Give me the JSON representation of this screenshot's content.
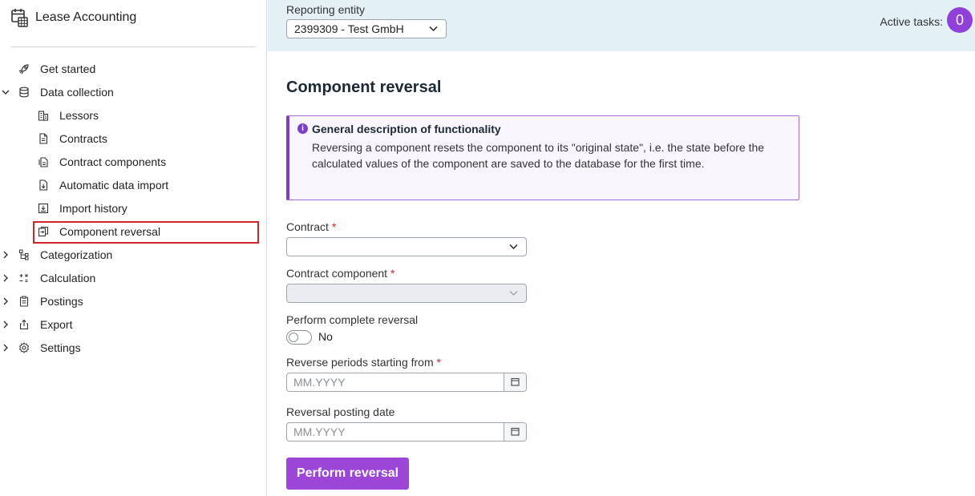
{
  "app": {
    "title": "Lease Accounting"
  },
  "sidebar": {
    "items": [
      {
        "label": "Get started"
      },
      {
        "label": "Data collection"
      },
      {
        "label": "Lessors"
      },
      {
        "label": "Contracts"
      },
      {
        "label": "Contract components"
      },
      {
        "label": "Automatic data import"
      },
      {
        "label": "Import history"
      },
      {
        "label": "Component reversal"
      },
      {
        "label": "Categorization"
      },
      {
        "label": "Calculation"
      },
      {
        "label": "Postings"
      },
      {
        "label": "Export"
      },
      {
        "label": "Settings"
      }
    ]
  },
  "topbar": {
    "entity_label": "Reporting entity",
    "entity_value": "2399309 - Test GmbH",
    "active_tasks_label": "Active tasks:",
    "active_tasks_count": "0"
  },
  "main": {
    "title": "Component reversal",
    "info": {
      "title": "General description of functionality",
      "text": "Reversing a component resets the component to its \"original state\", i.e. the state before the calculated values of the component are saved to the database for the first time."
    },
    "contract": {
      "label": "Contract",
      "required": "*",
      "value": ""
    },
    "component": {
      "label": "Contract component",
      "required": "*",
      "value": ""
    },
    "complete_reversal": {
      "label": "Perform complete reversal",
      "state": "No"
    },
    "reverse_from": {
      "label": "Reverse periods starting from",
      "required": "*",
      "placeholder": "MM.YYYY"
    },
    "posting_date": {
      "label": "Reversal posting date",
      "placeholder": "MM.YYYY"
    },
    "submit_label": "Perform reversal"
  },
  "colors": {
    "accent": "#9c46d8",
    "topbar_bg": "#e3f0f5",
    "active_outline": "#d0252b"
  }
}
